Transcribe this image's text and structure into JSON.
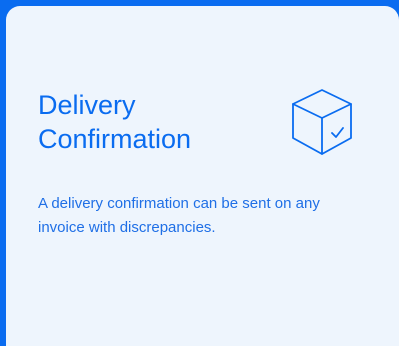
{
  "card": {
    "title_line1": "Delivery",
    "title_line2": "Confirmation",
    "icon": "package-check-icon",
    "description": "A delivery confirmation can be sent on any invoice with discrepancies."
  },
  "colors": {
    "accent": "#0a6cf0",
    "card_background": "#eef5fd",
    "text": "#1f6fe6"
  }
}
